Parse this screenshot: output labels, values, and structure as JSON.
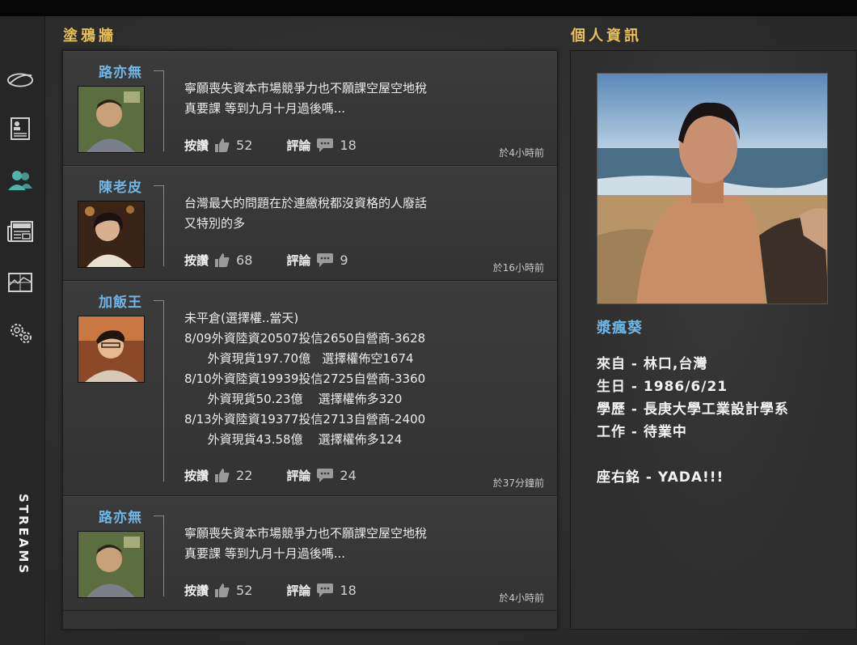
{
  "nav": {
    "streams_label": "STREAMS",
    "icons": [
      "logo-swoosh-icon",
      "profile-card-icon",
      "friends-icon",
      "news-icon",
      "chart-grid-icon",
      "settings-gears-icon"
    ]
  },
  "wall": {
    "title": "塗鴉牆",
    "posts": [
      {
        "author": "路亦無",
        "text": "寧願喪失資本市場競爭力也不願課空屋空地稅\n真要課 等到九月十月過後嗎...",
        "like_label": "按讚",
        "like_count": "52",
        "comment_label": "評論",
        "comment_count": "18",
        "time": "於4小時前"
      },
      {
        "author": "陳老皮",
        "text": "台灣最大的問題在於連繳稅都沒資格的人廢話\n又特別的多",
        "like_label": "按讚",
        "like_count": "68",
        "comment_label": "評論",
        "comment_count": "9",
        "time": "於16小時前"
      },
      {
        "author": "加飯王",
        "text": "未平倉(選擇權..當天)\n8/09外資陸資20507投信2650自營商-3628\n      外資現貨197.70億   選擇權佈空1674\n8/10外資陸資19939投信2725自營商-3360\n      外資現貨50.23億    選擇權佈多320\n8/13外資陸資19377投信2713自營商-2400\n      外資現貨43.58億    選擇權佈多124",
        "like_label": "按讚",
        "like_count": "22",
        "comment_label": "評論",
        "comment_count": "24",
        "time": "於37分鐘前"
      },
      {
        "author": "路亦無",
        "text": "寧願喪失資本市場競爭力也不願課空屋空地稅\n真要課 等到九月十月過後嗎...",
        "like_label": "按讚",
        "like_count": "52",
        "comment_label": "評論",
        "comment_count": "18",
        "time": "於4小時前"
      }
    ]
  },
  "profile": {
    "title": "個人資訊",
    "name": "漿瘋葵",
    "from": "來自 - 林口,台灣",
    "birthday": "生日 - 1986/6/21",
    "education": "學歷 - 長庚大學工業設計學系",
    "job": "工作 - 待業中",
    "motto": "座右銘 - YADA!!!"
  },
  "colors": {
    "accent_gold": "#e8c15a",
    "link_blue": "#6fb6e6",
    "nav_active": "#4fb3a8"
  }
}
